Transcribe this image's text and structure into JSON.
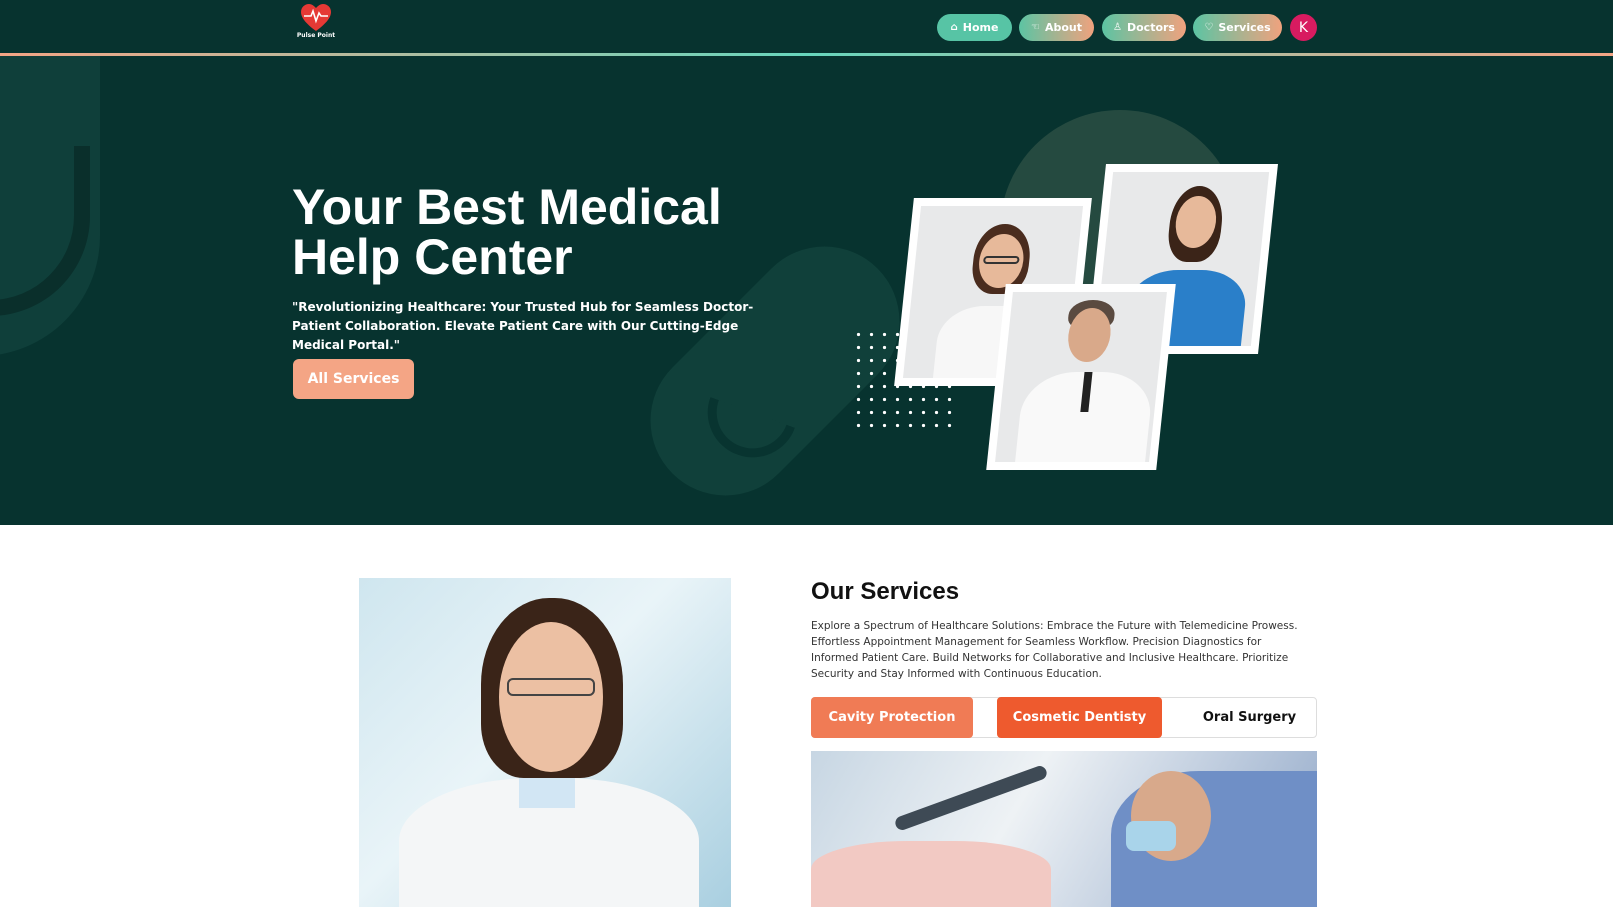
{
  "brand": {
    "name": "Pulse Point",
    "logo_color": "#e53935"
  },
  "nav": {
    "items": [
      {
        "label": "Home",
        "icon": "home-icon"
      },
      {
        "label": "About",
        "icon": "hand-icon"
      },
      {
        "label": "Doctors",
        "icon": "user-icon"
      },
      {
        "label": "Services",
        "icon": "stethoscope-icon"
      }
    ],
    "avatar_initial": "K"
  },
  "hero": {
    "title_line1": "Your Best Medical",
    "title_line2": "Help Center",
    "subtitle": "\"Revolutionizing Healthcare: Your Trusted Hub for Seamless Doctor-Patient Collaboration. Elevate Patient Care with Our Cutting-Edge Medical Portal.\"",
    "button_label": "All Services"
  },
  "services": {
    "title": "Our Services",
    "description": "Explore a Spectrum of Healthcare Solutions: Embrace the Future with Telemedicine Prowess. Effortless Appointment Management for Seamless Workflow. Precision Diagnostics for Informed Patient Care. Build Networks for Collaborative and Inclusive Healthcare. Prioritize Security and Stay Informed with Continuous Education.",
    "tabs": [
      {
        "label": "Cavity Protection"
      },
      {
        "label": "Cosmetic Dentisty"
      },
      {
        "label": "Oral Surgery"
      }
    ]
  },
  "colors": {
    "primary_dark": "#07332f",
    "accent_peach": "#f4a585",
    "accent_teal": "#57c4a5",
    "tab_active": "#ee5a2e",
    "avatar_bg": "#d81b60"
  }
}
